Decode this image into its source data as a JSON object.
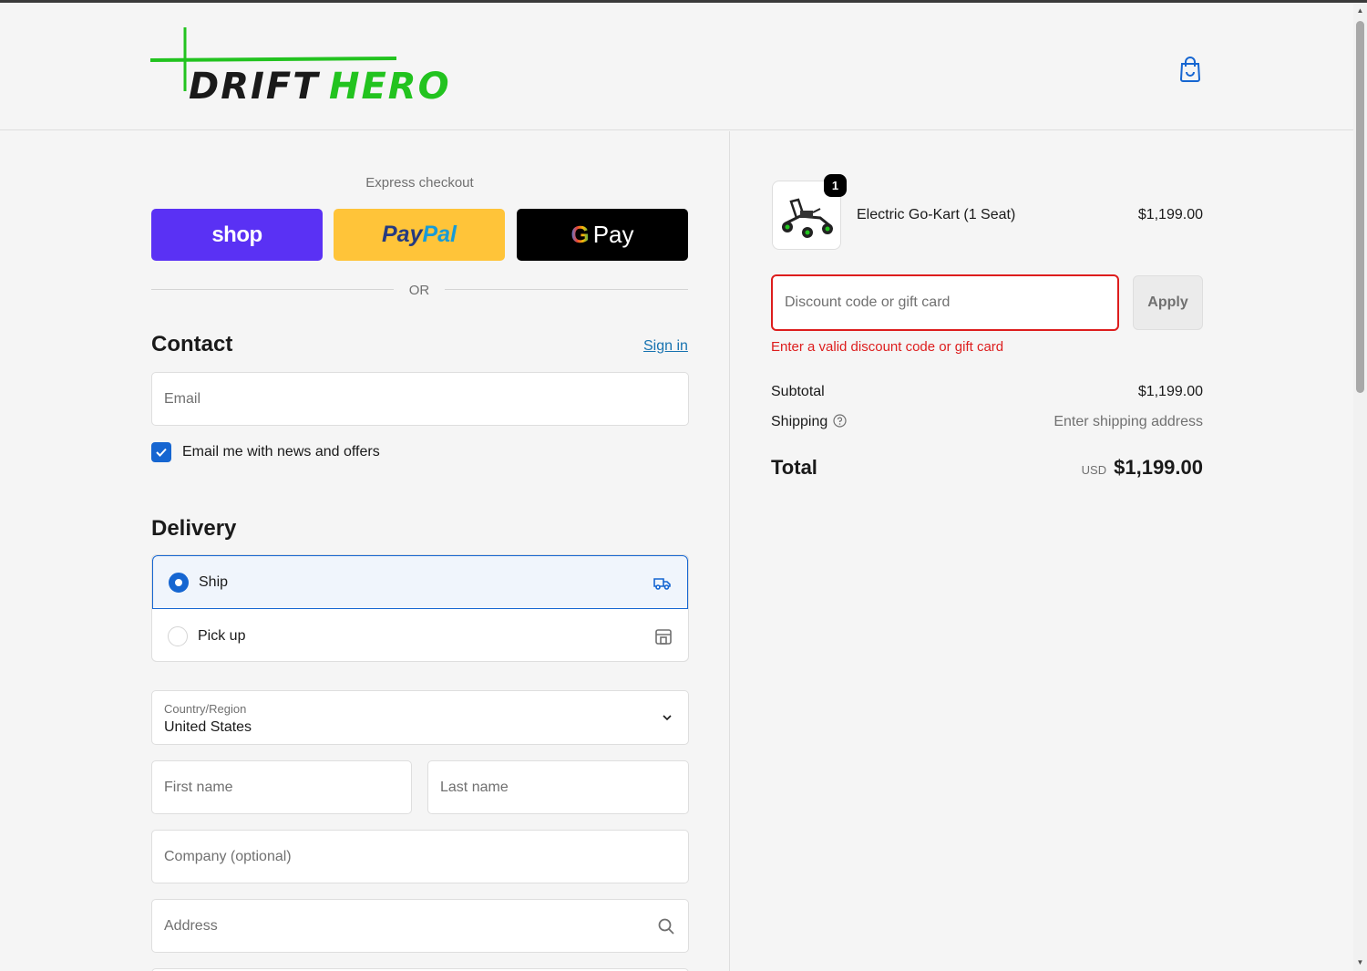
{
  "brand": {
    "name_part1": "DRIFT",
    "name_part2": "HERO",
    "accent_green": "#22c31f"
  },
  "header": {
    "cart_icon": "shopping-bag-icon"
  },
  "express": {
    "title": "Express checkout",
    "shop_label": "shop",
    "paypal_label_1": "Pay",
    "paypal_label_2": "Pal",
    "gpay_g": "G",
    "gpay_label": "Pay",
    "or_label": "OR"
  },
  "contact": {
    "heading": "Contact",
    "sign_in": "Sign in",
    "email_placeholder": "Email",
    "newsletter_label": "Email me with news and offers",
    "newsletter_checked": true
  },
  "delivery": {
    "heading": "Delivery",
    "options": [
      {
        "label": "Ship",
        "selected": true,
        "icon": "truck-icon"
      },
      {
        "label": "Pick up",
        "selected": false,
        "icon": "store-icon"
      }
    ],
    "country_label": "Country/Region",
    "country_value": "United States",
    "first_name_placeholder": "First name",
    "last_name_placeholder": "Last name",
    "company_placeholder": "Company (optional)",
    "address_placeholder": "Address"
  },
  "summary": {
    "item": {
      "name": "Electric Go-Kart (1 Seat)",
      "price": "$1,199.00",
      "quantity": "1"
    },
    "discount_placeholder": "Discount code or gift card",
    "apply_label": "Apply",
    "discount_error": "Enter a valid discount code or gift card",
    "subtotal_label": "Subtotal",
    "subtotal_value": "$1,199.00",
    "shipping_label": "Shipping",
    "shipping_value": "Enter shipping address",
    "total_label": "Total",
    "total_currency": "USD",
    "total_value": "$1,199.00"
  },
  "colors": {
    "primary_blue": "#1666d1",
    "error_red": "#dd1d1d",
    "shop_purple": "#5a31f4",
    "paypal_yellow": "#ffc439"
  }
}
